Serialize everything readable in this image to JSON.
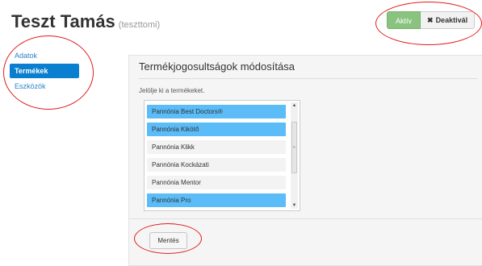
{
  "header": {
    "title": "Teszt Tamás",
    "username": "(teszttomi)"
  },
  "status_buttons": {
    "active_label": "Aktív",
    "deactivate_label": "Deaktivál",
    "active_color": "#8ac37f"
  },
  "sidebar": {
    "items": [
      {
        "label": "Adatok",
        "active": false
      },
      {
        "label": "Termékek",
        "active": true
      },
      {
        "label": "Eszközök",
        "active": false
      }
    ]
  },
  "panel": {
    "title": "Termékjogosultságok módosítása",
    "instruction": "Jelölje ki a termékeket.",
    "products": [
      {
        "label": "Pannónia Best Doctors®",
        "selected": true
      },
      {
        "label": "Pannónia Kikötő",
        "selected": true
      },
      {
        "label": "Pannónia Klikk",
        "selected": false
      },
      {
        "label": "Pannónia Kockázati",
        "selected": false
      },
      {
        "label": "Pannónia Mentor",
        "selected": false
      },
      {
        "label": "Pannónia Pro",
        "selected": true
      }
    ],
    "save_label": "Mentés"
  },
  "colors": {
    "selection": "#5bbcf7",
    "nav_active": "#0a7fcf",
    "annotation": "#e01b1b"
  }
}
